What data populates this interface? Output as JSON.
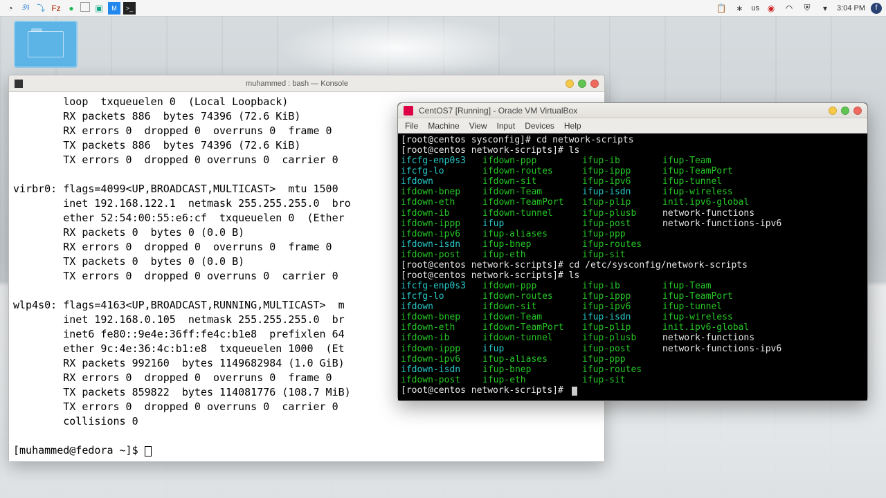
{
  "panel": {
    "input_lang": "us",
    "clock": "3:04 PM",
    "tray_left_icons": [
      "eclipse",
      "jedit",
      "dolphin",
      "filezilla",
      "spotify",
      "desktop",
      "virtualbox",
      "mail",
      "konsole"
    ],
    "tray_right_icons": [
      "clipboard",
      "bluetooth",
      "lang",
      "record",
      "wifi",
      "shield",
      "dropdown",
      "clock",
      "fedora"
    ]
  },
  "konsole": {
    "title": "muhammed : bash — Konsole",
    "lines": [
      "        loop  txqueuelen 0  (Local Loopback)",
      "        RX packets 886  bytes 74396 (72.6 KiB)",
      "        RX errors 0  dropped 0  overruns 0  frame 0",
      "        TX packets 886  bytes 74396 (72.6 KiB)",
      "        TX errors 0  dropped 0 overruns 0  carrier 0",
      "",
      "virbr0: flags=4099<UP,BROADCAST,MULTICAST>  mtu 1500",
      "        inet 192.168.122.1  netmask 255.255.255.0  bro",
      "        ether 52:54:00:55:e6:cf  txqueuelen 0  (Ether",
      "        RX packets 0  bytes 0 (0.0 B)",
      "        RX errors 0  dropped 0  overruns 0  frame 0",
      "        TX packets 0  bytes 0 (0.0 B)",
      "        TX errors 0  dropped 0 overruns 0  carrier 0",
      "",
      "wlp4s0: flags=4163<UP,BROADCAST,RUNNING,MULTICAST>  m",
      "        inet 192.168.0.105  netmask 255.255.255.0  br",
      "        inet6 fe80::9e4e:36ff:fe4c:b1e8  prefixlen 64",
      "        ether 9c:4e:36:4c:b1:e8  txqueuelen 1000  (Et",
      "        RX packets 992160  bytes 1149682984 (1.0 GiB)",
      "        RX errors 0  dropped 0  overruns 0  frame 0",
      "        TX packets 859822  bytes 114081776 (108.7 MiB)",
      "        TX errors 0  dropped 0 overruns 0  carrier 0",
      "        collisions 0",
      ""
    ],
    "prompt": "[muhammed@fedora ~]$ "
  },
  "vbox": {
    "title": "CentOS7 [Running] - Oracle VM VirtualBox",
    "menu": [
      "File",
      "Machine",
      "View",
      "Input",
      "Devices",
      "Help"
    ],
    "prompt1": "[root@centos sysconfig]# ",
    "cmd1": "cd network-scripts",
    "prompt2": "[root@centos network-scripts]# ",
    "cmd2": "ls",
    "cmd3": "cd /etc/sysconfig/network-scripts",
    "cmd4": "ls",
    "listing": [
      [
        "ifcfg-enp0s3",
        "ifdown-ppp",
        "ifup-ib",
        "ifup-Team",
        "cy",
        "gr",
        "gr",
        "gr"
      ],
      [
        "ifcfg-lo",
        "ifdown-routes",
        "ifup-ippp",
        "ifup-TeamPort",
        "cy",
        "gr",
        "gr",
        "gr"
      ],
      [
        "ifdown",
        "ifdown-sit",
        "ifup-ipv6",
        "ifup-tunnel",
        "cy",
        "gr",
        "gr",
        "gr"
      ],
      [
        "ifdown-bnep",
        "ifdown-Team",
        "ifup-isdn",
        "ifup-wireless",
        "gr",
        "gr",
        "cy",
        "gr"
      ],
      [
        "ifdown-eth",
        "ifdown-TeamPort",
        "ifup-plip",
        "init.ipv6-global",
        "gr",
        "gr",
        "gr",
        "gr"
      ],
      [
        "ifdown-ib",
        "ifdown-tunnel",
        "ifup-plusb",
        "network-functions",
        "gr",
        "gr",
        "gr",
        "wh"
      ],
      [
        "ifdown-ippp",
        "ifup",
        "ifup-post",
        "network-functions-ipv6",
        "gr",
        "cy",
        "gr",
        "wh"
      ],
      [
        "ifdown-ipv6",
        "ifup-aliases",
        "ifup-ppp",
        "",
        "gr",
        "gr",
        "gr",
        ""
      ],
      [
        "ifdown-isdn",
        "ifup-bnep",
        "ifup-routes",
        "",
        "cy",
        "gr",
        "gr",
        ""
      ],
      [
        "ifdown-post",
        "ifup-eth",
        "ifup-sit",
        "",
        "gr",
        "gr",
        "gr",
        ""
      ]
    ]
  }
}
